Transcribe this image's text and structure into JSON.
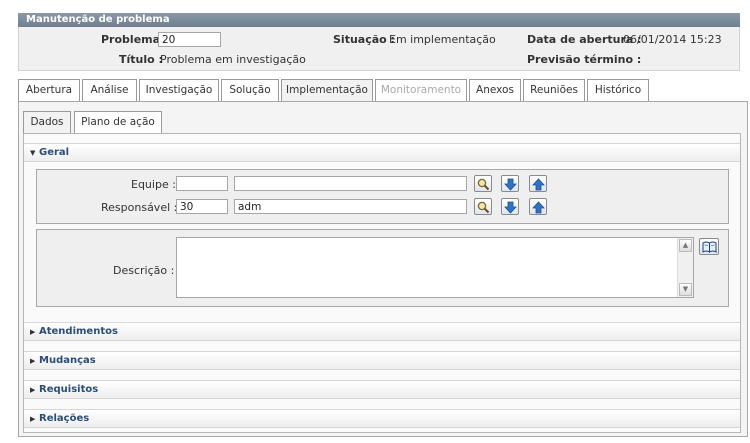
{
  "window": {
    "title": "Manutenção de problema"
  },
  "header": {
    "problema_label": "Problema :",
    "problema_value": "20",
    "situacao_label": "Situação :",
    "situacao_value": "Em implementação",
    "abertura_label": "Data de abertura :",
    "abertura_value": "06/01/2014 15:23",
    "titulo_label": "Título :",
    "titulo_value": "Problema em investigação",
    "previsao_label": "Previsão término :",
    "previsao_value": ""
  },
  "main_tabs": [
    {
      "label": "Abertura"
    },
    {
      "label": "Análise"
    },
    {
      "label": "Investigação"
    },
    {
      "label": "Solução"
    },
    {
      "label": "Implementação"
    },
    {
      "label": "Monitoramento"
    },
    {
      "label": "Anexos"
    },
    {
      "label": "Reuniões"
    },
    {
      "label": "Histórico"
    }
  ],
  "main_tabs_active": "Implementação",
  "main_tabs_disabled": "Monitoramento",
  "sub_tabs": [
    {
      "label": "Dados"
    },
    {
      "label": "Plano de ação"
    }
  ],
  "sections": {
    "geral": "Geral",
    "atendimentos": "Atendimentos",
    "mudancas": "Mudanças",
    "requisitos": "Requisitos",
    "relacoes": "Relações"
  },
  "geral": {
    "equipe_label": "Equipe :",
    "equipe_code": "",
    "equipe_name": "",
    "responsavel_label": "Responsável :",
    "responsavel_code": "30",
    "responsavel_name": "adm",
    "descricao_label": "Descrição :",
    "descricao_value": ""
  },
  "icons": {
    "search": "search-icon",
    "down": "arrow-down-icon",
    "up": "arrow-up-icon",
    "book": "book-icon"
  },
  "colors": {
    "titlebar": "#7d8b99",
    "section_text": "#2a4e7a",
    "arrow_blue": "#2f73c9"
  }
}
